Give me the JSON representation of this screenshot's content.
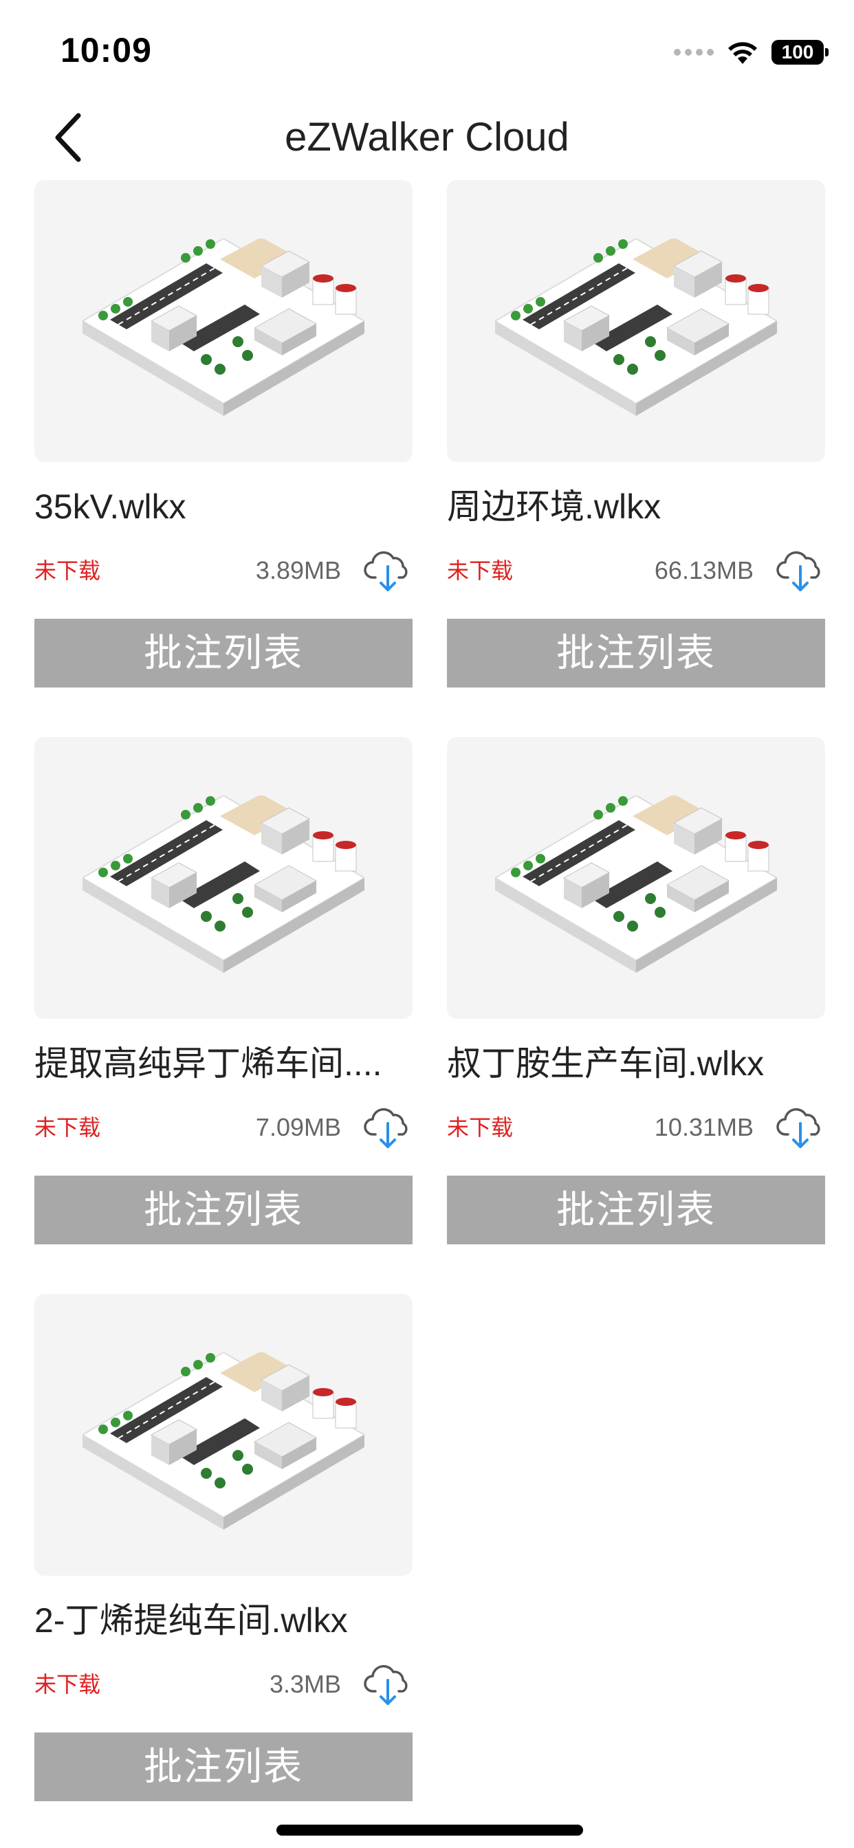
{
  "status_bar": {
    "time": "10:09",
    "battery": "100",
    "icons": [
      "signal-dots-icon",
      "wifi-icon",
      "battery-icon"
    ]
  },
  "nav": {
    "title": "eZWalker Cloud",
    "back_icon": "chevron-left-icon"
  },
  "colors": {
    "not_downloaded": "#e02020",
    "button_bg": "#a8a8a8",
    "download_arrow": "#2a90e8",
    "thumb_bg": "#f4f4f4"
  },
  "files": [
    {
      "name": "35kV.wlkx",
      "status": "未下载",
      "size": "3.89MB",
      "button": "批注列表",
      "thumb_icon": "isometric-city-icon",
      "download_icon": "cloud-download-icon"
    },
    {
      "name": "周边环境.wlkx",
      "status": "未下载",
      "size": "66.13MB",
      "button": "批注列表",
      "thumb_icon": "isometric-city-icon",
      "download_icon": "cloud-download-icon"
    },
    {
      "name": "提取高纯异丁烯车间....",
      "status": "未下载",
      "size": "7.09MB",
      "button": "批注列表",
      "thumb_icon": "isometric-city-icon",
      "download_icon": "cloud-download-icon"
    },
    {
      "name": "叔丁胺生产车间.wlkx",
      "status": "未下载",
      "size": "10.31MB",
      "button": "批注列表",
      "thumb_icon": "isometric-city-icon",
      "download_icon": "cloud-download-icon"
    },
    {
      "name": "2-丁烯提纯车间.wlkx",
      "status": "未下载",
      "size": "3.3MB",
      "button": "批注列表",
      "thumb_icon": "isometric-city-icon",
      "download_icon": "cloud-download-icon"
    }
  ]
}
